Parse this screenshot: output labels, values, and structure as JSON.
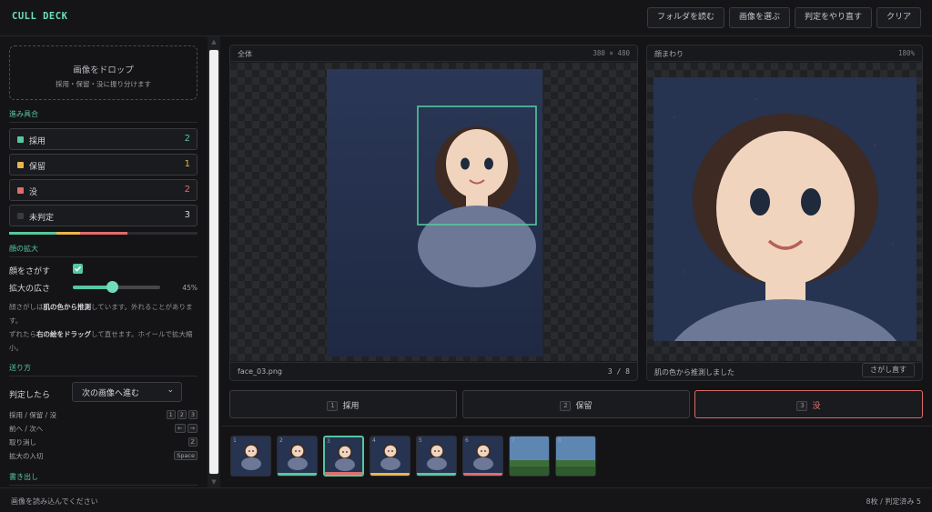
{
  "app": {
    "title": "CULL DECK"
  },
  "toolbar": {
    "buttons": [
      {
        "label": "フォルダを読む"
      },
      {
        "label": "画像を選ぶ"
      },
      {
        "label": "判定をやり直す"
      },
      {
        "label": "クリア"
      }
    ]
  },
  "sidebar": {
    "dropzone": {
      "title": "画像をドロップ",
      "subtitle": "採用・保留・没に振り分けます"
    },
    "progress": {
      "title": "進み具合",
      "items": [
        {
          "label": "採用",
          "count": "2",
          "color": "#56c79f"
        },
        {
          "label": "保留",
          "count": "1",
          "color": "#e8b64a"
        },
        {
          "label": "没",
          "count": "2",
          "color": "#e06c6c"
        },
        {
          "label": "未判定",
          "count": "3",
          "color": "#3a3b40"
        }
      ],
      "bar_fractions": {
        "keep": 0.25,
        "hold": 0.125,
        "reject": 0.25
      }
    },
    "zoom": {
      "title": "顔の拡大",
      "face_search_label": "顔をさがす",
      "face_search_checked": true,
      "range_label": "拡大の広さ",
      "range_value": "45%",
      "range_fraction": 0.45,
      "help1_pre": "顔さがしは",
      "help1_bold": "肌の色から推測",
      "help1_post": "しています。外れることがあります。",
      "help2_pre": "ずれたら",
      "help2_bold": "右の絵をドラッグ",
      "help2_post": "して直せます。ホイールで拡大縮小。"
    },
    "send": {
      "title": "送り方",
      "after_label": "判定したら",
      "after_value": "次の画像へ進む",
      "shortcuts": [
        {
          "label": "採用 / 保留 / 没",
          "keys": [
            "1",
            "2",
            "3"
          ]
        },
        {
          "label": "前へ / 次へ",
          "keys": [
            "←",
            "→"
          ]
        },
        {
          "label": "取り消し",
          "keys": [
            "Z"
          ]
        },
        {
          "label": "拡大の入切",
          "keys": [
            "Space"
          ]
        }
      ]
    },
    "export": {
      "title": "書き出し"
    }
  },
  "viewer": {
    "full": {
      "title": "全体",
      "dims": "380 × 480",
      "filename": "face_03.png",
      "index": "3 / 8"
    },
    "face": {
      "title": "顔まわり",
      "zoom": "180%",
      "note": "肌の色から推測しました",
      "redo_label": "さがし直す"
    }
  },
  "judge": [
    {
      "key": "1",
      "label": "採用"
    },
    {
      "key": "2",
      "label": "保留"
    },
    {
      "key": "3",
      "label": "没"
    }
  ],
  "thumbnails": [
    {
      "n": "1",
      "status": "none",
      "kind": "face"
    },
    {
      "n": "2",
      "status": "keep",
      "kind": "face"
    },
    {
      "n": "3",
      "status": "reject",
      "kind": "face",
      "selected": true
    },
    {
      "n": "4",
      "status": "hold",
      "kind": "face"
    },
    {
      "n": "5",
      "status": "keep",
      "kind": "face"
    },
    {
      "n": "6",
      "status": "reject",
      "kind": "face"
    },
    {
      "n": "7",
      "status": "none",
      "kind": "landscape"
    },
    {
      "n": "8",
      "status": "none",
      "kind": "landscape"
    }
  ],
  "status": {
    "left": "画像を読み込んでください",
    "right": "8枚 / 判定済み 5"
  },
  "colors": {
    "accent": "#56c79f",
    "keep": "#56c79f",
    "hold": "#e8b64a",
    "reject": "#e06c6c",
    "portrait_bg": "#263351"
  }
}
